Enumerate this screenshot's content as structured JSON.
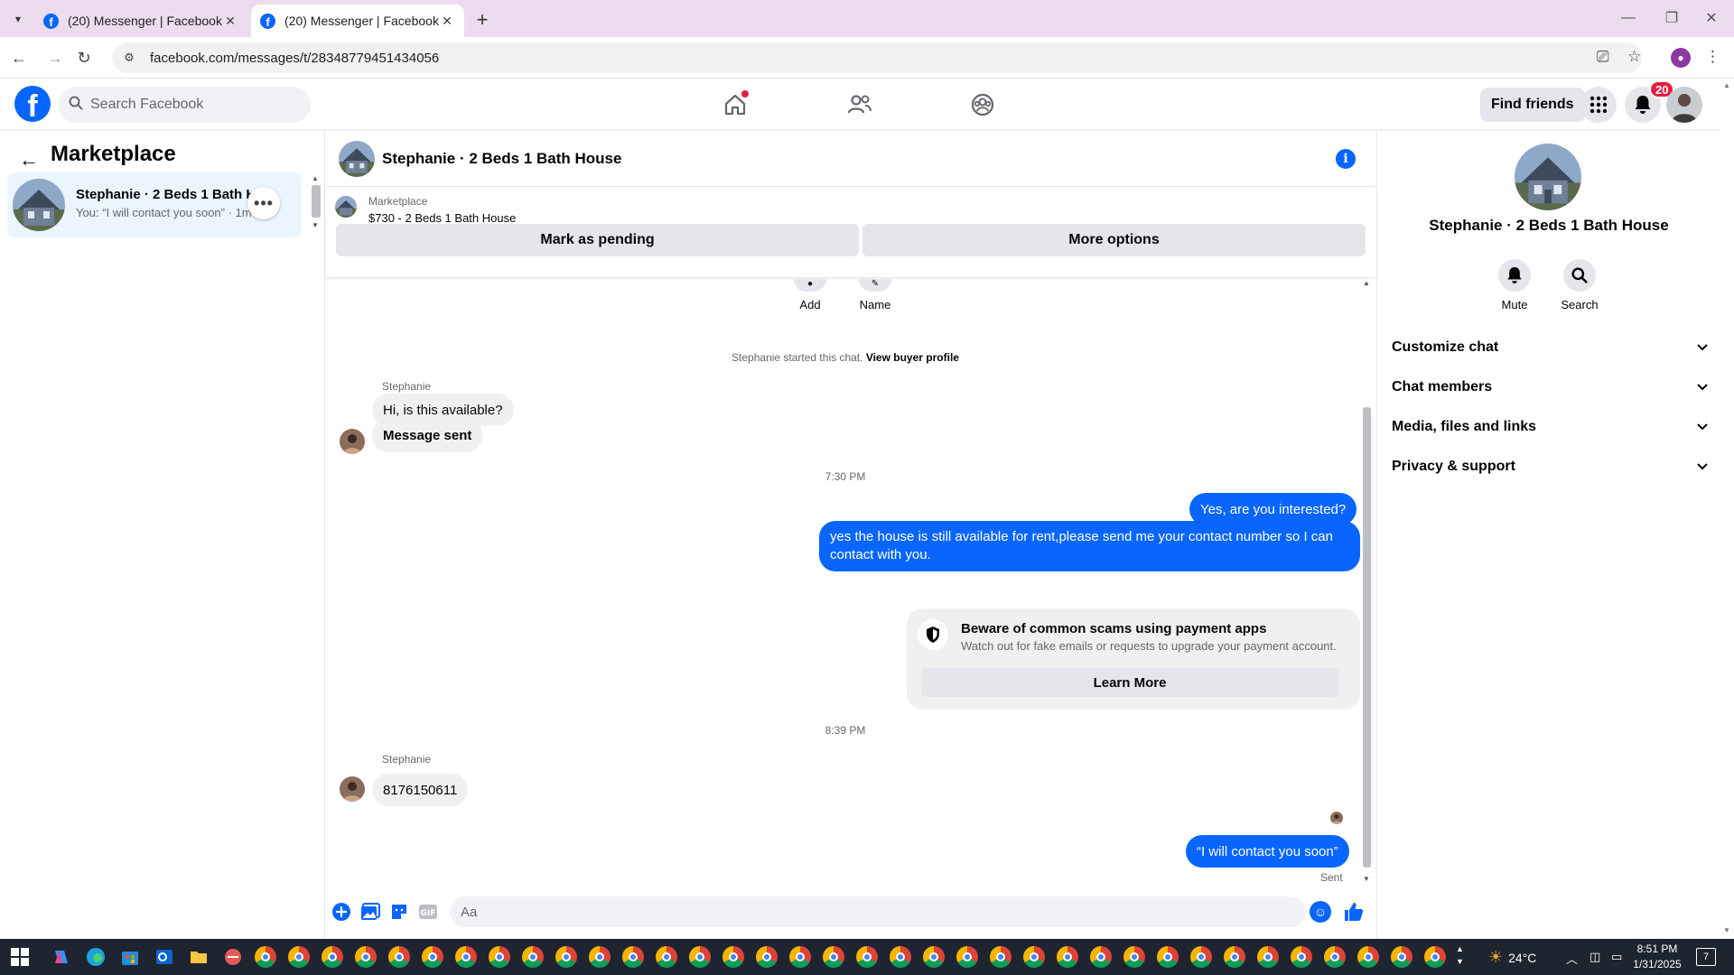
{
  "browser": {
    "tabs": [
      {
        "title": "(20) Messenger | Facebook",
        "active": false
      },
      {
        "title": "(20) Messenger | Facebook",
        "active": true
      }
    ],
    "url": "facebook.com/messages/t/28348779451434056"
  },
  "fb": {
    "search_placeholder": "Search Facebook",
    "find_friends_label": "Find friends",
    "notification_count": "20"
  },
  "sidebar": {
    "title": "Marketplace",
    "conversation": {
      "name": "Stephanie · 2 Beds 1 Bath House",
      "preview": "You: “I will contact you soon” · 1m"
    }
  },
  "chat": {
    "title": "Stephanie · 2 Beds 1 Bath House",
    "listing": {
      "label": "Marketplace",
      "price_line": "$730 - 2 Beds 1 Bath House",
      "mark_pending_label": "Mark as pending",
      "more_options_label": "More options"
    },
    "partial_actions": {
      "add": "Add",
      "name": "Name"
    },
    "started_text": "Stephanie started this chat.",
    "view_profile_link": "View buyer profile",
    "messages": {
      "sender_1": "Stephanie",
      "in_1": "Hi, is this available?",
      "in_2": "Message sent",
      "time_1": "7:30 PM",
      "out_1": "Yes, are you interested?",
      "out_2": "yes the house is still available for rent,please send me your contact number so I can contact with you.",
      "scam_title": "Beware of common scams using payment apps",
      "scam_desc": "Watch out for fake emails or requests to upgrade your payment account.",
      "learn_more": "Learn More",
      "time_2": "8:39 PM",
      "sender_2": "Stephanie",
      "in_3": "8176150611",
      "out_3": "“I will contact you soon”",
      "status": "Sent"
    },
    "composer_placeholder": "Aa"
  },
  "info_panel": {
    "name": "Stephanie · 2 Beds 1 Bath House",
    "mute_label": "Mute",
    "search_label": "Search",
    "sections": [
      "Customize chat",
      "Chat members",
      "Media, files and links",
      "Privacy & support"
    ]
  },
  "taskbar": {
    "temperature": "24°C",
    "time": "8:51 PM",
    "date": "1/31/2025",
    "notification_count": "7"
  },
  "colors": {
    "fb_blue": "#0866ff",
    "bubble_gray": "#f0f0f0",
    "tab_bar": "#eddcef",
    "badge_red": "#e41e3f",
    "taskbar": "#1e2430"
  }
}
